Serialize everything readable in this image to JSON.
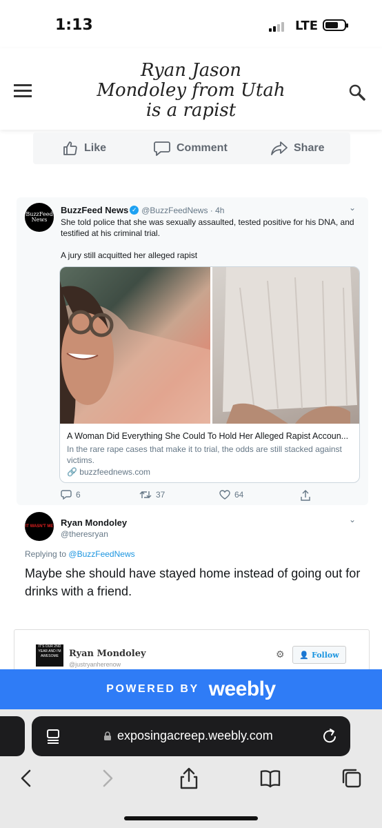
{
  "status_bar": {
    "time": "1:13",
    "network": "LTE"
  },
  "site": {
    "title": "Ryan Jason Mondoley from Utah is a rapist"
  },
  "facebook_actions": {
    "like": "Like",
    "comment": "Comment",
    "share": "Share"
  },
  "tweet": {
    "avatar_text": "BuzzFeed News",
    "name": "BuzzFeed News",
    "handle": "@BuzzFeedNews · 4h",
    "text_1": "She told police that she was sexually assaulted, tested positive for his DNA, and testified at his criminal trial.",
    "text_2": "A jury still acquitted her alleged rapist",
    "card_title": "A Woman Did Everything She Could To Hold Her Alleged Rapist Accoun...",
    "card_description": "In the rare rape cases that make it to trial, the odds are still stacked against victims.",
    "card_domain": "buzzfeednews.com",
    "replies": "6",
    "retweets": "37",
    "likes": "64"
  },
  "reply": {
    "avatar_text": "IT WASN'T ME",
    "name": "Ryan Mondoley",
    "handle": "@theresryan",
    "replying_prefix": "Replying to",
    "replying_to": "@BuzzFeedNews",
    "text": "Maybe she should have stayed home instead of going out for drinks with a friend."
  },
  "second_embed": {
    "avatar_text": "IT'S OUR 2ND YEAR AND I'M AWESOME",
    "name": "Ryan Mondoley",
    "handle": "@justryanherenow",
    "follow_label": "Follow"
  },
  "weebly": {
    "powered_by": "POWERED BY",
    "logo": "weebly"
  },
  "browser": {
    "url": "exposingacreep.weebly.com"
  },
  "colors": {
    "weebly_blue": "#2f7cf6",
    "twitter_blue": "#1da1f2"
  }
}
